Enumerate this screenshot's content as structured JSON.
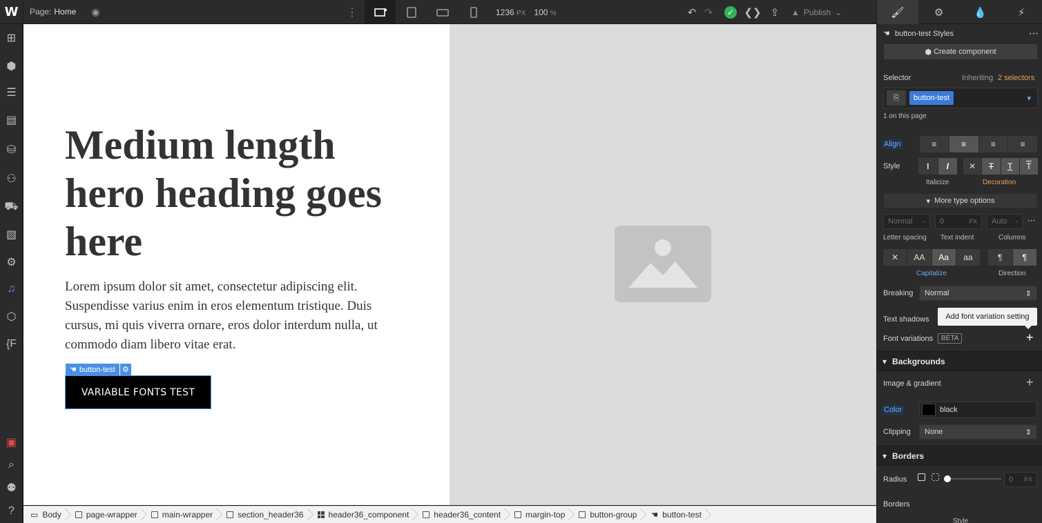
{
  "topbar": {
    "logo": "W",
    "page_prefix": "Page:",
    "page_name": "Home",
    "canvas_width": "1236",
    "canvas_width_unit": "PX",
    "zoom": "100",
    "zoom_unit": "%",
    "publish_label": "Publish"
  },
  "canvas": {
    "heading": "Medium length hero heading goes here",
    "paragraph": "Lorem ipsum dolor sit amet, consectetur adipiscing elit. Suspendisse varius enim in eros elementum tristique. Duis cursus, mi quis viverra ornare, eros dolor interdum nulla, ut commodo diam libero vitae erat.",
    "selected_tag": "button-test",
    "button_label": "VARIABLE FONTS TEST"
  },
  "breadcrumbs": [
    "Body",
    "page-wrapper",
    "main-wrapper",
    "section_header36",
    "header36_component",
    "header36_content",
    "margin-top",
    "button-group",
    "button-test"
  ],
  "panel": {
    "styles_title": "button-test Styles",
    "create_component": "Create component",
    "selector_label": "Selector",
    "inheriting_prefix": "Inheriting",
    "inheriting_link": "2 selectors",
    "selector_chip": "button-test",
    "on_page": "1 on this page",
    "align_label": "Align",
    "style_label": "Style",
    "italicize_label": "Italicize",
    "decoration_label": "Decoration",
    "more_type": "More type options",
    "letter_spacing_value": "Normal",
    "letter_spacing_label": "Letter spacing",
    "text_indent_value": "0",
    "text_indent_unit": "PX",
    "text_indent_label": "Text indent",
    "columns_value": "Auto",
    "columns_label": "Columns",
    "capitalize_label": "Capitalize",
    "direction_label": "Direction",
    "breaking_label": "Breaking",
    "breaking_value": "Normal",
    "text_shadows_label": "Text shadows",
    "tooltip": "Add font variation setting",
    "font_variations_label": "Font variations",
    "beta": "BETA",
    "backgrounds_title": "Backgrounds",
    "image_gradient_label": "Image & gradient",
    "color_label": "Color",
    "color_value": "black",
    "clipping_label": "Clipping",
    "clipping_value": "None",
    "borders_title": "Borders",
    "radius_label": "Radius",
    "radius_value": "0",
    "radius_unit": "PX",
    "borders_label": "Borders",
    "style_sub_label": "Style"
  },
  "colors": {
    "accent_blue": "#4a90e2",
    "success_green": "#33b25a",
    "decoration_orange": "#e8a25a"
  }
}
